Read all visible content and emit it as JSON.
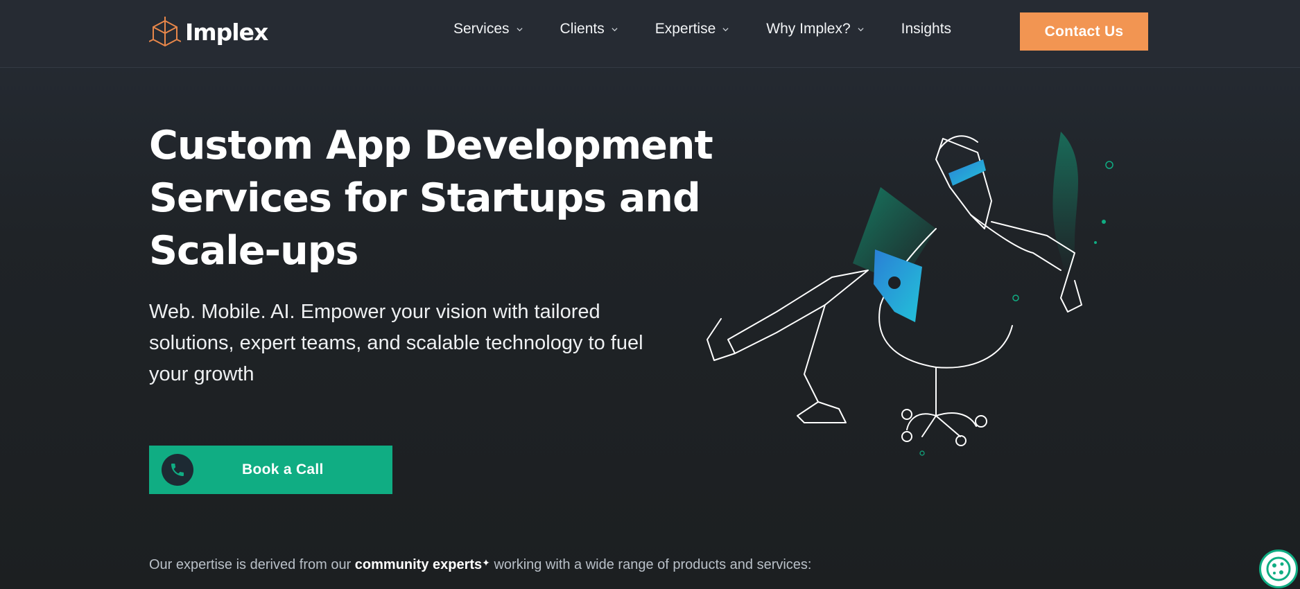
{
  "header": {
    "logo_text": "Implex",
    "nav": [
      {
        "label": "Services",
        "has_dropdown": true
      },
      {
        "label": "Clients",
        "has_dropdown": true
      },
      {
        "label": "Expertise",
        "has_dropdown": true
      },
      {
        "label": "Why Implex?",
        "has_dropdown": true
      },
      {
        "label": "Insights",
        "has_dropdown": false
      }
    ],
    "contact_label": "Contact Us"
  },
  "hero": {
    "title_line1": "Custom App Development",
    "title_line2": "Services for Startups and",
    "title_line3": "Scale-ups",
    "subtitle_line1": "Web. Mobile. AI. Empower your vision with tailored",
    "subtitle_line2": "solutions, expert teams, and scalable technology to fuel",
    "subtitle_line3": "your growth",
    "cta_label": "Book a Call"
  },
  "expertise": {
    "prefix": "Our expertise is derived from our ",
    "highlight": "community experts",
    "suffix": " working with a wide range of products and services:"
  },
  "colors": {
    "accent_orange": "#f29552",
    "accent_green": "#10ad83",
    "background": "#1f2327"
  },
  "icons": {
    "logo": "cube-logo-icon",
    "dropdown": "chevron-down-icon",
    "phone": "phone-icon",
    "cookie": "cookie-icon"
  }
}
